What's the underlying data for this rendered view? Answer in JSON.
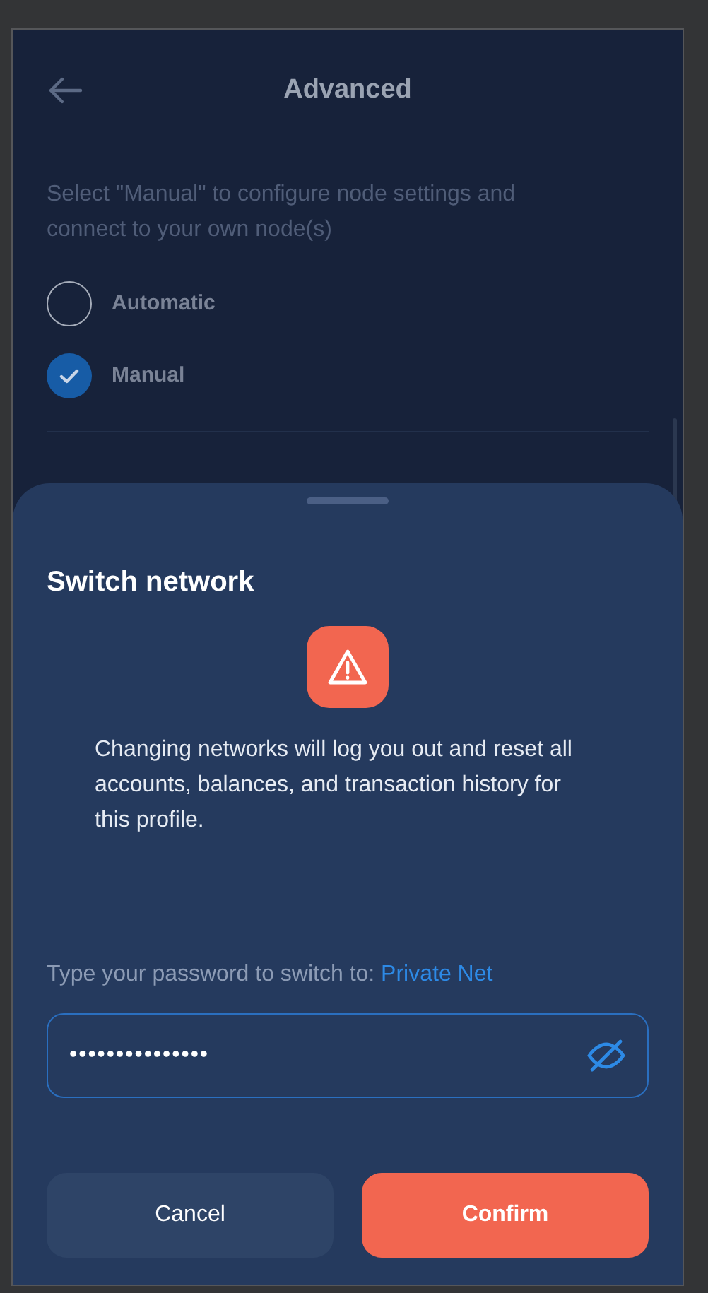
{
  "header": {
    "title": "Advanced"
  },
  "description": "Select \"Manual\" to configure node settings and connect to your own node(s)",
  "options": [
    {
      "label": "Automatic",
      "selected": false
    },
    {
      "label": "Manual",
      "selected": true
    }
  ],
  "sheet": {
    "title": "Switch network",
    "message": "Changing networks will log you out and reset all accounts, balances, and transaction history for this profile.",
    "prompt": "Type your password to switch to:",
    "network": "Private Net",
    "password": {
      "value": "•••••••••••••••",
      "revealed": false
    },
    "buttons": [
      {
        "label": "Cancel",
        "kind": "secondary"
      },
      {
        "label": "Confirm",
        "kind": "primary"
      }
    ]
  }
}
